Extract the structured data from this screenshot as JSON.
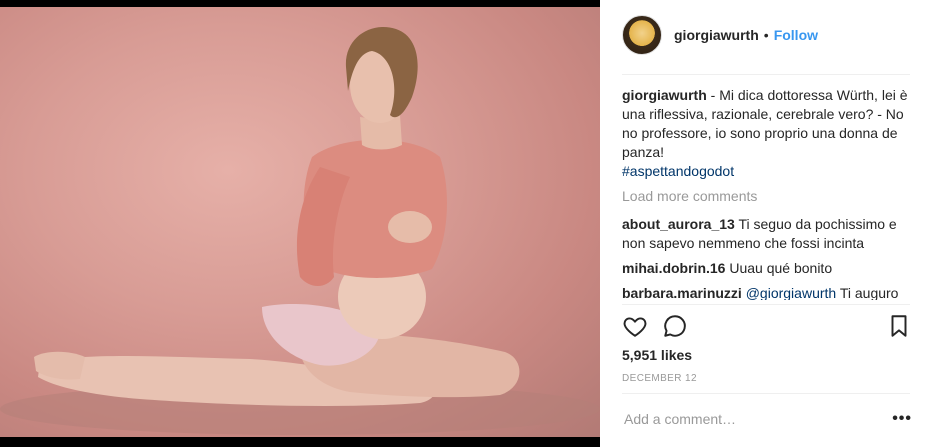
{
  "header": {
    "username": "giorgiawurth",
    "separator": "•",
    "follow_label": "Follow"
  },
  "caption": {
    "username": "giorgiawurth",
    "text": "- Mi dica dottoressa Würth, lei è una riflessiva, razionale, cerebrale vero? - No no professore, io sono proprio una donna de panza!",
    "hashtag": "#aspettandogodot"
  },
  "load_more": "Load more comments",
  "comments": [
    {
      "user": "about_aurora_13",
      "text": "Ti seguo da pochissimo e non sapevo nemmeno che fossi incinta"
    },
    {
      "user": "mihai.dobrin.16",
      "text": "Uuau qué bonito"
    },
    {
      "user": "barbara.marinuzzi",
      "mention": "@giorgiawurth",
      "text": "Ti auguro tante felicità 😍 ●●●●●●●●●●e grazie di"
    }
  ],
  "likes": "5,951 likes",
  "date": "DECEMBER 12",
  "add_comment_placeholder": "Add a comment…",
  "more_label": "•••",
  "icons": [
    "heart-icon",
    "comment-icon",
    "bookmark-icon"
  ]
}
